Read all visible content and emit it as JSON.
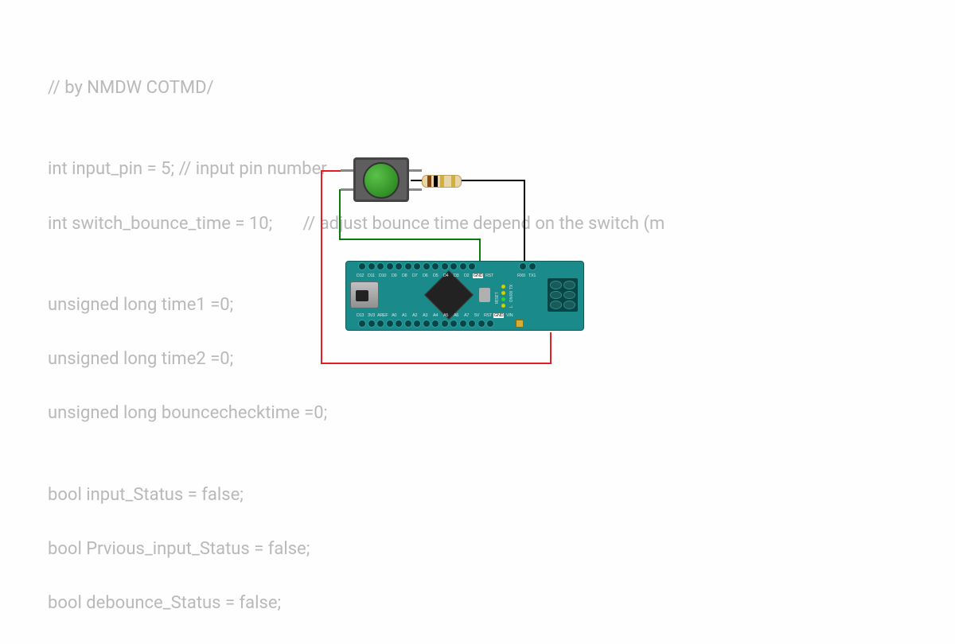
{
  "code": {
    "line1": "// by NMDW COTMD/",
    "line2": "",
    "line3": "int input_pin = 5; // input pin number",
    "line4": "int switch_bounce_time = 10;       // adjust bounce time depend on the switch (m",
    "line5": "",
    "line6": "unsigned long time1 =0;",
    "line7": "unsigned long time2 =0;",
    "line8": "unsigned long bouncechecktime =0;",
    "line9": "",
    "line10": "bool input_Status = false;",
    "line11": "bool Prvious_input_Status = false;",
    "line12": "bool debounce_Status = false;"
  },
  "board": {
    "name": "Arduino Nano",
    "top_pins": [
      "D12",
      "D11",
      "D10",
      "D9",
      "D8",
      "D7",
      "D6",
      "D5",
      "D4",
      "D3",
      "D2",
      "GND",
      "RST"
    ],
    "top_right_pins": [
      "RX0",
      "TX1"
    ],
    "bottom_pins": [
      "D13",
      "3V3",
      "AREF",
      "A0",
      "A1",
      "A2",
      "A3",
      "A4",
      "A5",
      "A6",
      "A7",
      "5V",
      "RST",
      "GND",
      "VIN"
    ],
    "side_labels": [
      "TX",
      "RX",
      "ON",
      "L"
    ],
    "reset_label": "RESET"
  },
  "components": {
    "button": "push-button",
    "resistor": "pull-down-resistor",
    "wires": {
      "red": "5V power",
      "green": "signal D2",
      "black": "GND"
    }
  }
}
